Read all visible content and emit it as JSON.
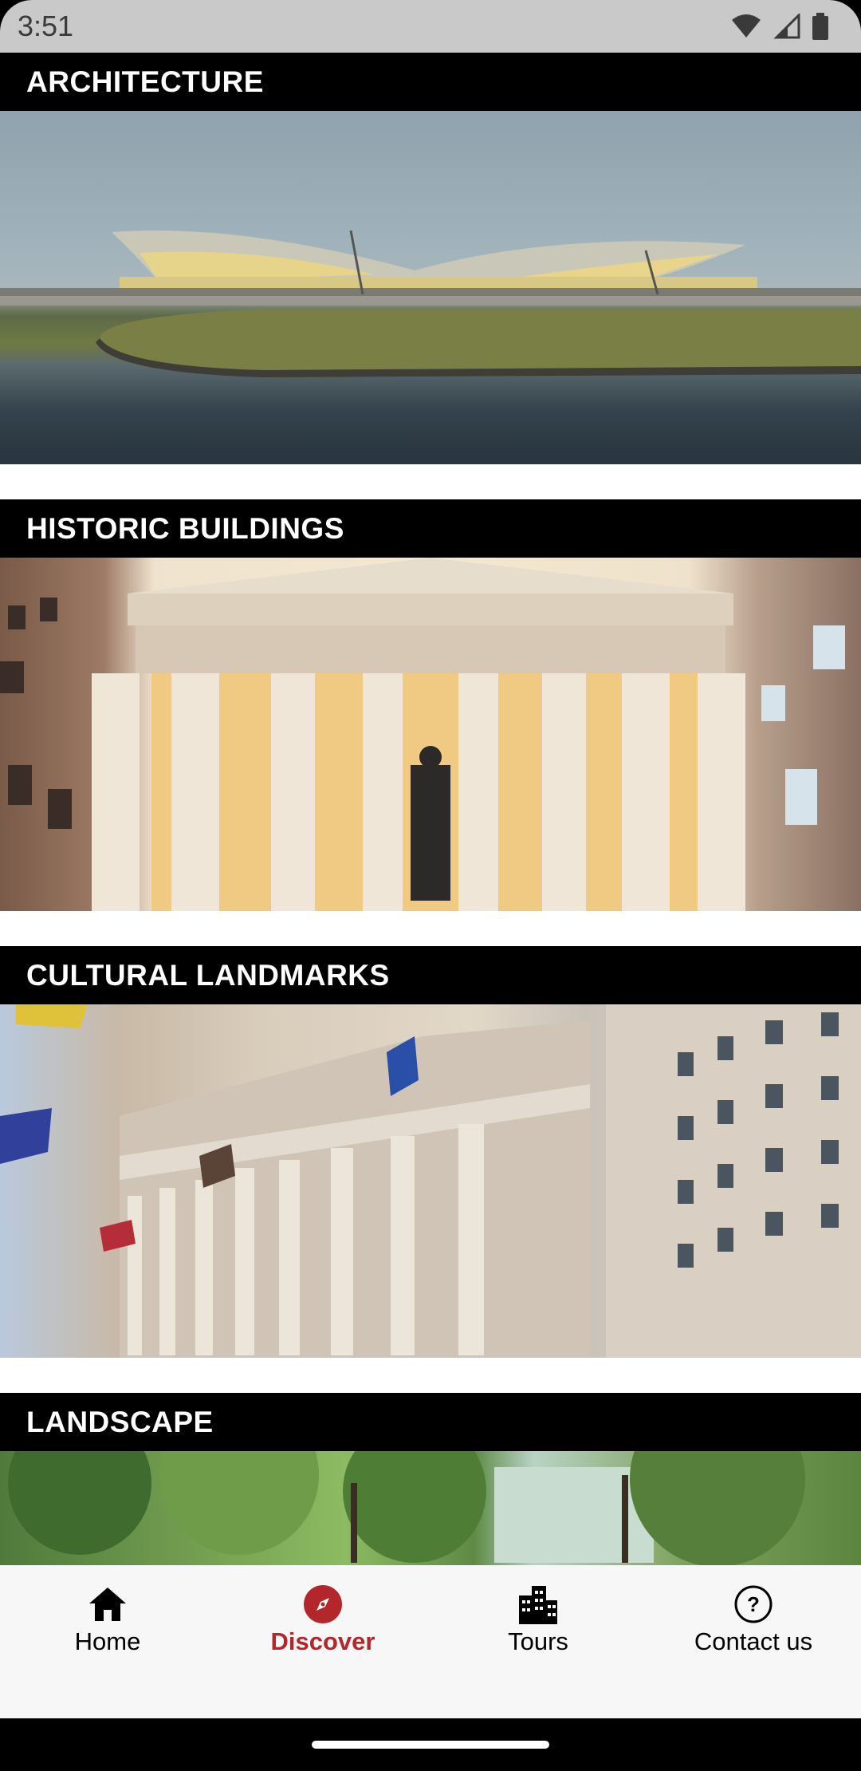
{
  "status_bar": {
    "time": "3:51",
    "icons": [
      "wifi-icon",
      "signal-icon",
      "battery-icon"
    ]
  },
  "categories": [
    {
      "title": "ARCHITECTURE",
      "image": "modern-terminal-photo"
    },
    {
      "title": "HISTORIC BUILDINGS",
      "image": "columned-hall-photo"
    },
    {
      "title": "CULTURAL LANDMARKS",
      "image": "stock-exchange-facade-photo"
    },
    {
      "title": "LANDSCAPE",
      "image": "park-trees-photo"
    }
  ],
  "nav": {
    "items": [
      {
        "label": "Home",
        "icon": "home-icon"
      },
      {
        "label": "Discover",
        "icon": "compass-icon"
      },
      {
        "label": "Tours",
        "icon": "buildings-icon"
      },
      {
        "label": "Contact us",
        "icon": "help-circle-icon"
      }
    ],
    "active": "Discover"
  },
  "colors": {
    "accent": "#b3262b",
    "header_bg": "#000000",
    "nav_bg": "#f7f7f7"
  }
}
